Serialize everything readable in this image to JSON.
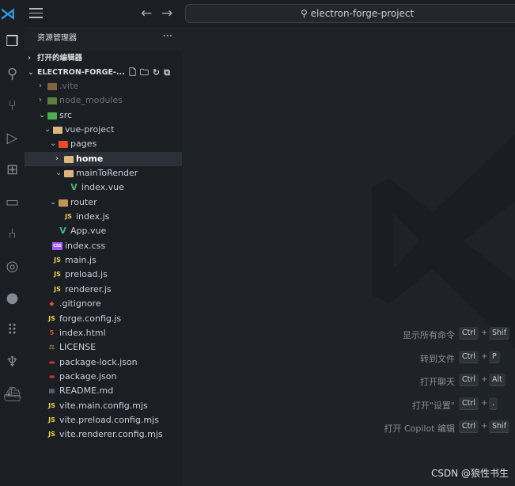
{
  "titlebar": {
    "search_text": "electron-forge-project",
    "back": "←",
    "forward": "→"
  },
  "activity": [
    "files-icon",
    "search-icon",
    "source-control-icon",
    "run-debug-icon",
    "extensions-icon",
    "remote-explorer-icon",
    "git-graph-icon",
    "gitlens-icon",
    "github-icon",
    "grid-icon",
    "postgres-icon",
    "docker-icon"
  ],
  "sidebar": {
    "title": "资源管理器",
    "more": "···",
    "open_editors": "打开的编辑器",
    "project": "ELECTRON-FORGE-...",
    "tree": [
      {
        "name": ".vite",
        "level": 0,
        "type": "folder",
        "open": false,
        "color": "#c09553",
        "dim": true
      },
      {
        "name": "node_modules",
        "level": 0,
        "type": "folder",
        "open": false,
        "color": "#8bc34a",
        "dim": true
      },
      {
        "name": "src",
        "level": 0,
        "type": "folder",
        "open": true,
        "color": "#4caf50"
      },
      {
        "name": "vue-project",
        "level": 1,
        "type": "folder",
        "open": true,
        "color": "#dcb67a"
      },
      {
        "name": "pages",
        "level": 2,
        "type": "folder",
        "open": true,
        "color": "#e44d26"
      },
      {
        "name": "home",
        "level": 3,
        "type": "folder",
        "open": false,
        "color": "#dcb67a",
        "selected": true
      },
      {
        "name": "mainToRender",
        "level": 3,
        "type": "folder",
        "open": true,
        "color": "#dcb67a"
      },
      {
        "name": "index.vue",
        "level": 4,
        "type": "vue"
      },
      {
        "name": "router",
        "level": 2,
        "type": "folder",
        "open": true,
        "color": "#c09553"
      },
      {
        "name": "index.js",
        "level": 3,
        "type": "js"
      },
      {
        "name": "App.vue",
        "level": 2,
        "type": "vue"
      },
      {
        "name": "index.css",
        "level": 1,
        "type": "css"
      },
      {
        "name": "main.js",
        "level": 1,
        "type": "js"
      },
      {
        "name": "preload.js",
        "level": 1,
        "type": "js"
      },
      {
        "name": "renderer.js",
        "level": 1,
        "type": "js"
      },
      {
        "name": ".gitignore",
        "level": 0,
        "type": "git"
      },
      {
        "name": "forge.config.js",
        "level": 0,
        "type": "js"
      },
      {
        "name": "index.html",
        "level": 0,
        "type": "html"
      },
      {
        "name": "LICENSE",
        "level": 0,
        "type": "license"
      },
      {
        "name": "package-lock.json",
        "level": 0,
        "type": "npm"
      },
      {
        "name": "package.json",
        "level": 0,
        "type": "npm"
      },
      {
        "name": "README.md",
        "level": 0,
        "type": "md"
      },
      {
        "name": "vite.main.config.mjs",
        "level": 0,
        "type": "js"
      },
      {
        "name": "vite.preload.config.mjs",
        "level": 0,
        "type": "js"
      },
      {
        "name": "vite.renderer.config.mjs",
        "level": 0,
        "type": "js"
      }
    ]
  },
  "shortcuts": [
    {
      "label": "显示所有命令",
      "keys": [
        "Ctrl",
        "Shif"
      ]
    },
    {
      "label": "转到文件",
      "keys": [
        "Ctrl",
        "P"
      ]
    },
    {
      "label": "打开聊天",
      "keys": [
        "Ctrl",
        "Alt"
      ]
    },
    {
      "label": "打开\"设置\"",
      "keys": [
        "Ctrl",
        "."
      ]
    },
    {
      "label": "打开 Copilot 编辑",
      "keys": [
        "Ctrl",
        "Shif"
      ]
    }
  ],
  "watermark_text": "CSDN @狼性书生"
}
